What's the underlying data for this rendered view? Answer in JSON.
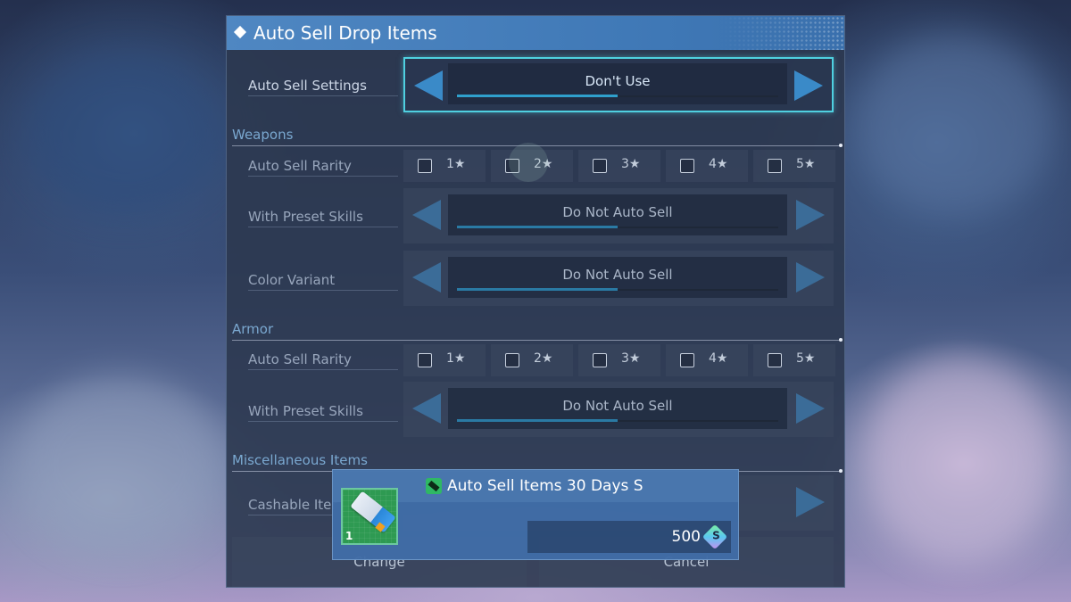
{
  "dialog": {
    "title": "Auto Sell Drop Items",
    "auto_sell_settings": {
      "label": "Auto Sell Settings",
      "value": "Don't Use"
    }
  },
  "weapons": {
    "heading": "Weapons",
    "rarity": {
      "label": "Auto Sell Rarity",
      "options": [
        {
          "label": "1★",
          "checked": false
        },
        {
          "label": "2★",
          "checked": false
        },
        {
          "label": "3★",
          "checked": false
        },
        {
          "label": "4★",
          "checked": false
        },
        {
          "label": "5★",
          "checked": false
        }
      ]
    },
    "preset_skills": {
      "label": "With Preset Skills",
      "value": "Do Not Auto Sell"
    },
    "color_variant": {
      "label": "Color Variant",
      "value": "Do Not Auto Sell"
    }
  },
  "armor": {
    "heading": "Armor",
    "rarity": {
      "label": "Auto Sell Rarity",
      "options": [
        {
          "label": "1★",
          "checked": false
        },
        {
          "label": "2★",
          "checked": false
        },
        {
          "label": "3★",
          "checked": false
        },
        {
          "label": "4★",
          "checked": false
        },
        {
          "label": "5★",
          "checked": false
        }
      ]
    },
    "preset_skills": {
      "label": "With Preset Skills",
      "value": "Do Not Auto Sell"
    }
  },
  "misc": {
    "heading": "Miscellaneous Items",
    "cashable": {
      "label": "Cashable Iter"
    }
  },
  "buttons": {
    "change": "Change",
    "cancel": "Cancel"
  },
  "popup": {
    "item_name": "Auto Sell Items 30 Days S",
    "count": "1",
    "price": "500",
    "currency_symbol": "S"
  },
  "colors": {
    "accent": "#4fd0e0",
    "title_bar": "#4f87c2",
    "section_heading": "#7aa8d0",
    "popup_bg": "#406ca6"
  }
}
